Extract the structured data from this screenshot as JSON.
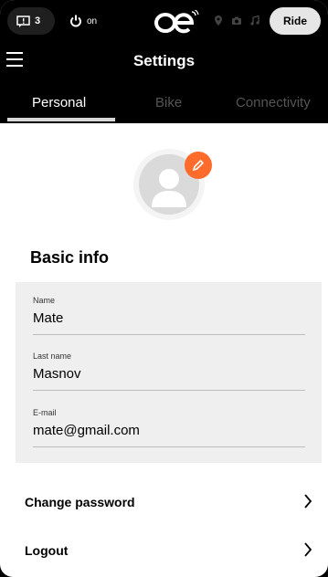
{
  "status": {
    "notification_count": "3",
    "power_label": "on",
    "ride_label": "Ride"
  },
  "header": {
    "title": "Settings"
  },
  "tabs": [
    {
      "label": "Personal",
      "active": true
    },
    {
      "label": "Bike",
      "active": false
    },
    {
      "label": "Connectivity",
      "active": false
    }
  ],
  "section": {
    "title": "Basic info"
  },
  "form": {
    "fields": [
      {
        "label": "Name",
        "value": "Mate"
      },
      {
        "label": "Last name",
        "value": "Masnov"
      },
      {
        "label": "E-mail",
        "value": "mate@gmail.com"
      }
    ]
  },
  "actions": {
    "change_password": "Change password",
    "logout": "Logout"
  },
  "colors": {
    "accent": "#ff6b2b",
    "topbar": "#000000",
    "form_bg": "#efefef"
  }
}
